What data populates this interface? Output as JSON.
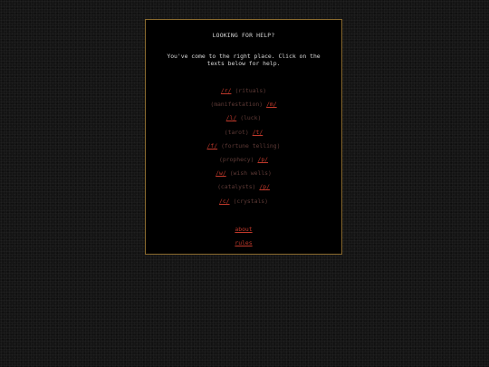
{
  "panel": {
    "title": "LOOKING FOR HELP?",
    "intro": "You've come to the right place. Click on the texts below for help."
  },
  "links": [
    {
      "code": "/r/",
      "desc": "(rituals)",
      "order": "code-first"
    },
    {
      "code": "/m/",
      "desc": "(manifestation)",
      "order": "desc-first"
    },
    {
      "code": "/l/",
      "desc": "(luck)",
      "order": "code-first"
    },
    {
      "code": "/t/",
      "desc": "(tarot)",
      "order": "desc-first"
    },
    {
      "code": "/f/",
      "desc": "(fortune telling)",
      "order": "code-first"
    },
    {
      "code": "/p/",
      "desc": "(prophecy)",
      "order": "desc-first"
    },
    {
      "code": "/w/",
      "desc": "(wish wells)",
      "order": "code-first"
    },
    {
      "code": "/p/",
      "desc": "(catalysts)",
      "order": "desc-first"
    },
    {
      "code": "/c/",
      "desc": "(crystals)",
      "order": "code-first"
    }
  ],
  "footer": {
    "about": "about",
    "rules": "rules"
  },
  "colors": {
    "link": "#c0392b",
    "desc": "#5e3a36",
    "border": "#8a6a2e",
    "panel_bg": "#000000"
  }
}
